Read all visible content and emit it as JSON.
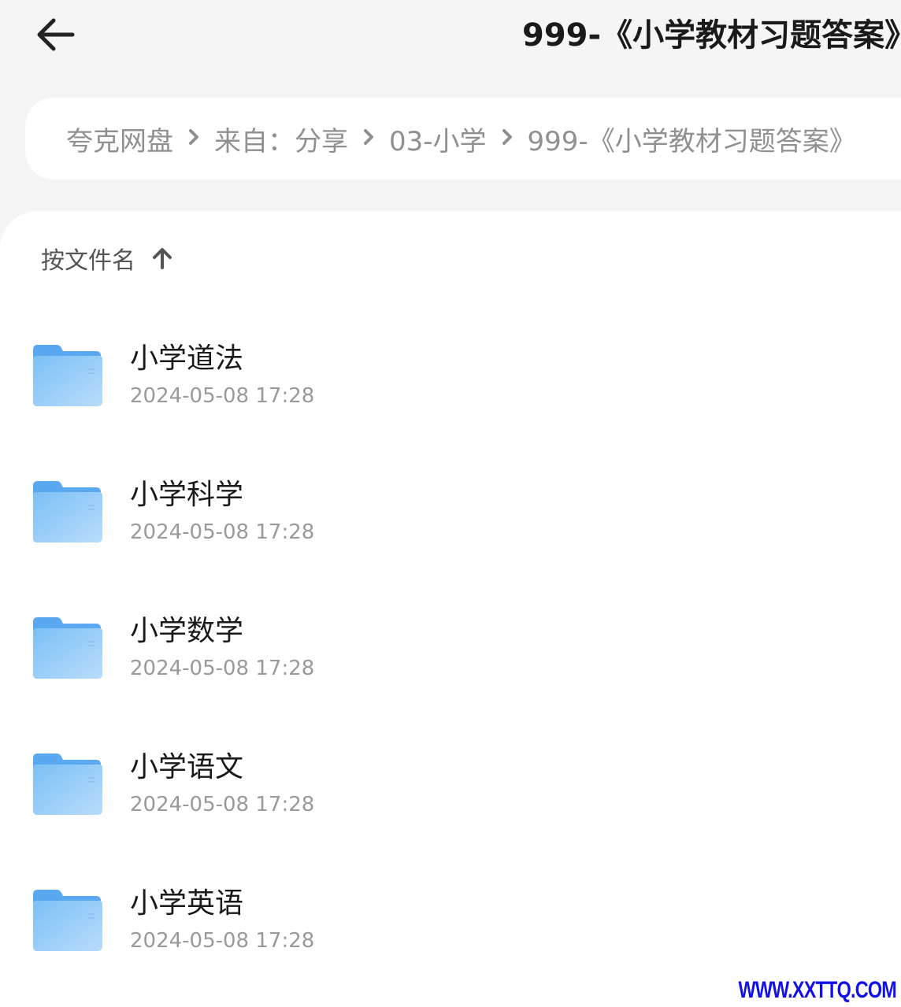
{
  "header": {
    "title": "999-《小学教材习题答案》"
  },
  "breadcrumb": [
    "夸克网盘",
    "来自：分享",
    "03-小学",
    "999-《小学教材习题答案》"
  ],
  "sort": {
    "label": "按文件名",
    "icon": "arrow-up-icon"
  },
  "files": [
    {
      "name": "小学道法",
      "date": "2024-05-08 17:28",
      "icon": "folder-icon"
    },
    {
      "name": "小学科学",
      "date": "2024-05-08 17:28",
      "icon": "folder-icon"
    },
    {
      "name": "小学数学",
      "date": "2024-05-08 17:28",
      "icon": "folder-icon"
    },
    {
      "name": "小学语文",
      "date": "2024-05-08 17:28",
      "icon": "folder-icon"
    },
    {
      "name": "小学英语",
      "date": "2024-05-08 17:28",
      "icon": "folder-icon"
    }
  ],
  "watermark": "WWW.XXTTQ.COM",
  "colors": {
    "folder": "#6cb6f3",
    "background": "#f5f5f5",
    "card": "#ffffff",
    "watermark": "#1212e8"
  }
}
